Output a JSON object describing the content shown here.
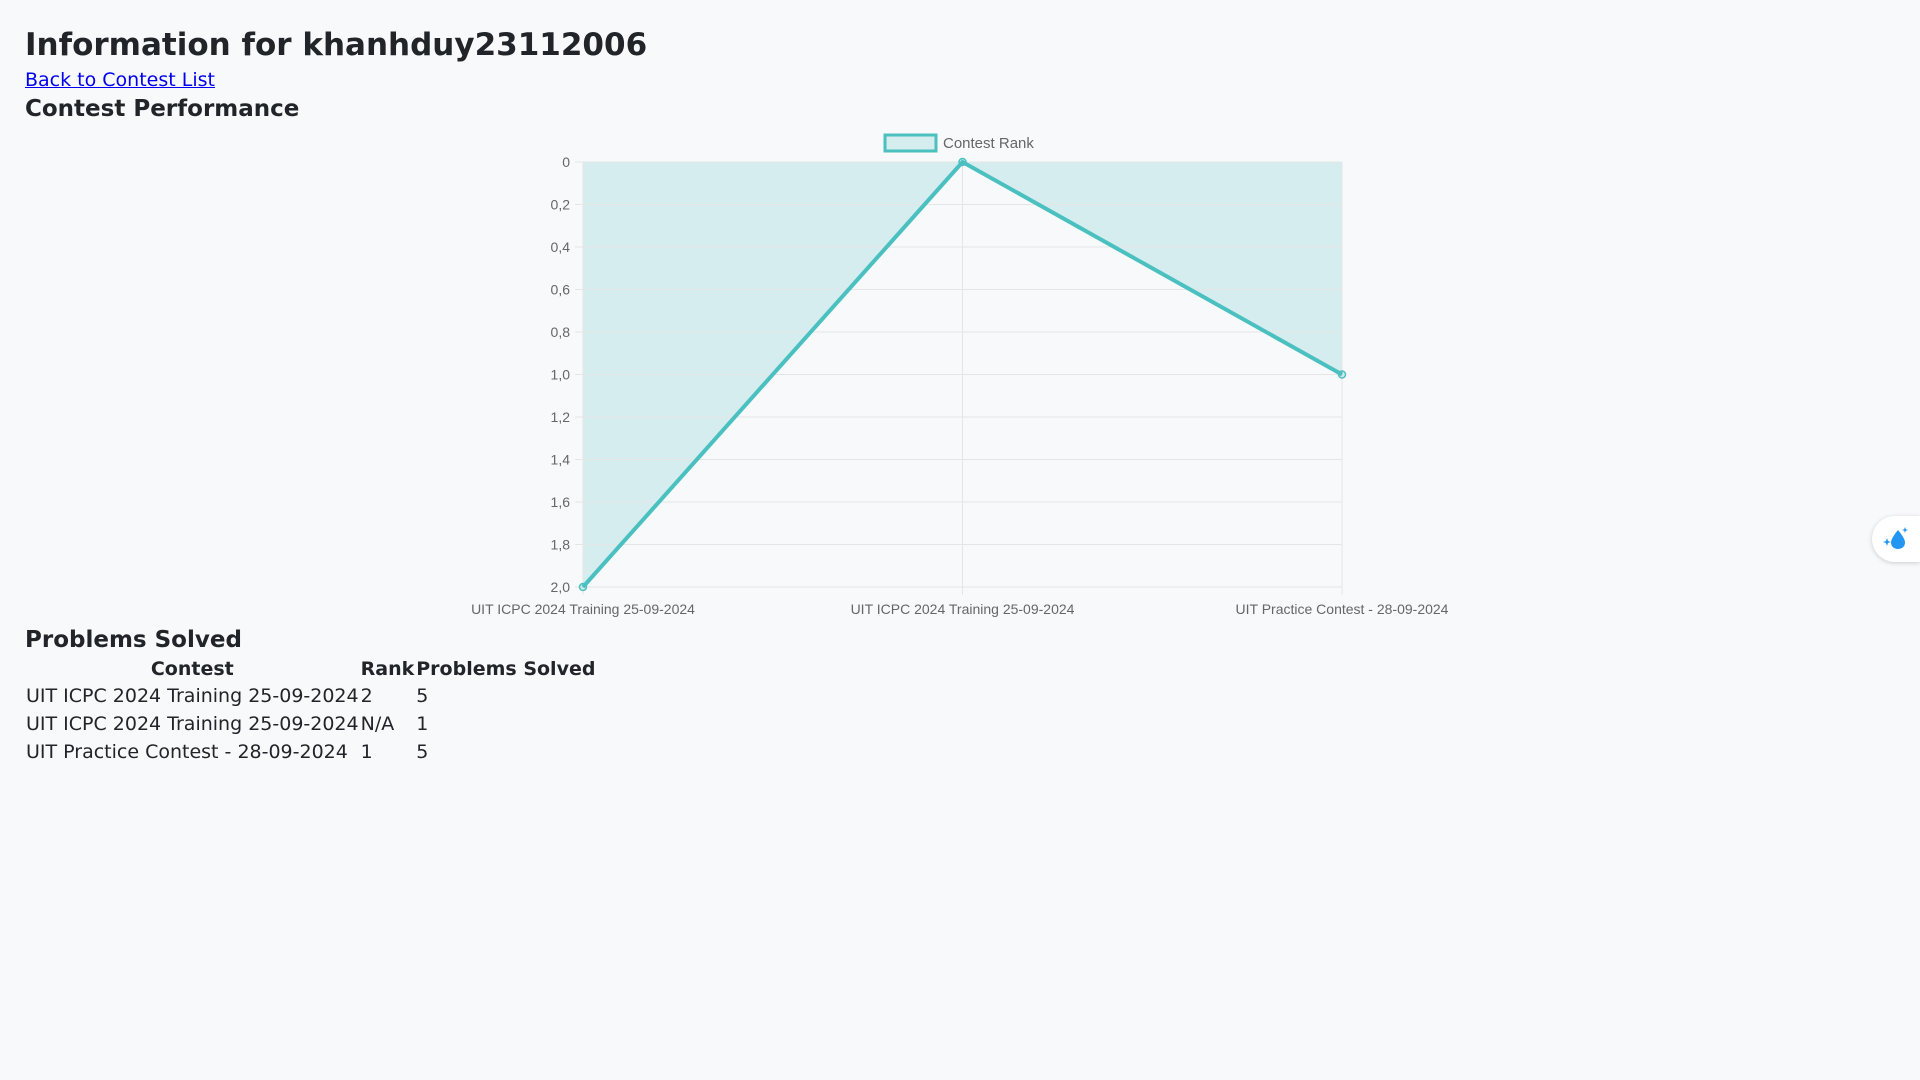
{
  "page": {
    "title": "Information for khanhduy23112006",
    "back_link": "Back to Contest List",
    "performance_heading": "Contest Performance",
    "solved_heading": "Problems Solved"
  },
  "colors": {
    "series_line": "#4bc0c0",
    "series_fill": "rgba(75,192,192,0.2)",
    "grid": "#e5e5e5",
    "tick_text": "#666666",
    "link": "#0000ee",
    "float_icon": "#2196f3"
  },
  "chart_data": {
    "type": "area",
    "categories": [
      "UIT ICPC 2024 Training 25-09-2024",
      "UIT ICPC 2024 Training 25-09-2024",
      "UIT Practice Contest - 28-09-2024"
    ],
    "series": [
      {
        "name": "Contest Rank",
        "values": [
          2,
          0,
          1
        ]
      }
    ],
    "ylim": [
      0,
      2
    ],
    "y_reversed": true,
    "yticks": [
      "0",
      "0,2",
      "0,4",
      "0,6",
      "0,8",
      "1,0",
      "1,2",
      "1,4",
      "1,6",
      "1,8",
      "2,0"
    ],
    "grid": true,
    "legend_position": "top"
  },
  "table": {
    "headers": [
      "Contest",
      "Rank",
      "Problems Solved"
    ],
    "rows": [
      [
        "UIT ICPC 2024 Training 25-09-2024",
        "2",
        "5"
      ],
      [
        "UIT ICPC 2024 Training 25-09-2024",
        "N/A",
        "1"
      ],
      [
        "UIT Practice Contest - 28-09-2024",
        "1",
        "5"
      ]
    ]
  },
  "float_button": {
    "icon": "water-drop-sparkle-icon"
  }
}
